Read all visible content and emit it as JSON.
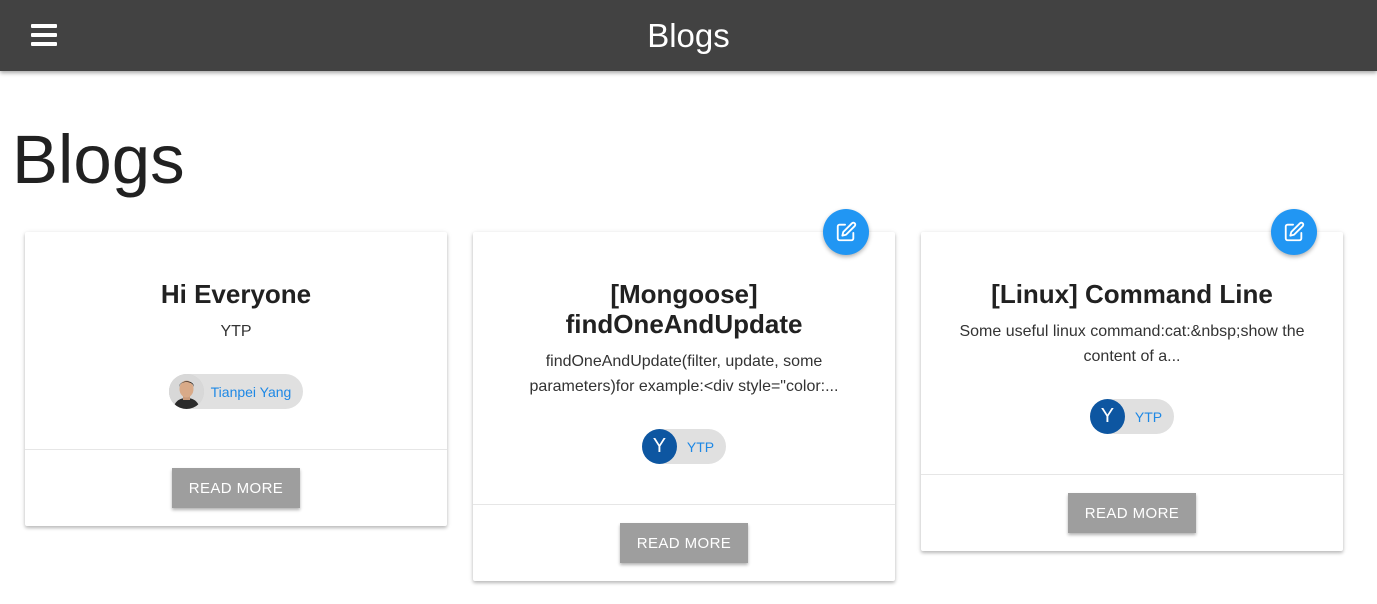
{
  "appbar": {
    "title": "Blogs",
    "menu_icon": "menu-icon"
  },
  "page": {
    "title": "Blogs"
  },
  "colors": {
    "appbar": "#424242",
    "fab": "#2196f3",
    "avatar": "#0d56a1",
    "chip_label": "#1e88e5",
    "button": "#9e9e9e"
  },
  "cards": [
    {
      "title": "Hi Everyone",
      "description": "YTP",
      "author": {
        "name": "Tianpei Yang",
        "avatar_type": "photo"
      },
      "action_label": "READ MORE",
      "editable": false
    },
    {
      "title": "[Mongoose] findOneAndUpdate",
      "description": "findOneAndUpdate(filter, update, some parameters)for example:<div style=\"color:...",
      "author": {
        "name": "YTP",
        "avatar_letter": "Y"
      },
      "action_label": "READ MORE",
      "editable": true,
      "edit_icon": "edit-icon"
    },
    {
      "title": "[Linux] Command Line",
      "description": "Some useful linux command:cat:&nbsp;show the content of a...",
      "author": {
        "name": "YTP",
        "avatar_letter": "Y"
      },
      "action_label": "READ MORE",
      "editable": true,
      "edit_icon": "edit-icon"
    }
  ]
}
